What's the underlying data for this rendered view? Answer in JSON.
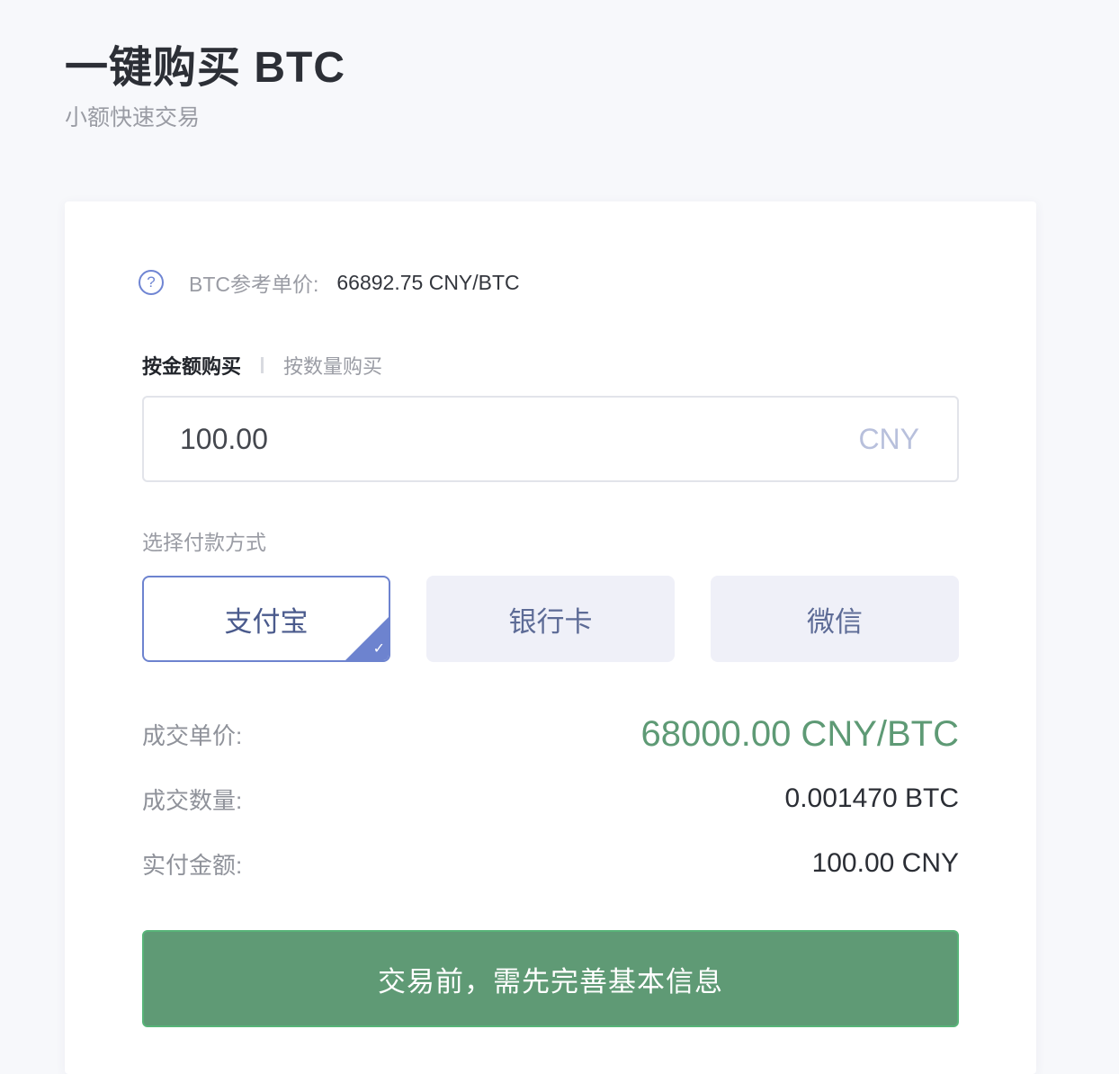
{
  "header": {
    "title": "一键购买 BTC",
    "subtitle": "小额快速交易"
  },
  "reference_price": {
    "icon": "help-icon",
    "icon_glyph": "?",
    "label": "BTC参考单价:",
    "value": "66892.75 CNY/BTC"
  },
  "purchase_tabs": [
    {
      "label": "按金额购买",
      "active": true
    },
    {
      "label": "按数量购买",
      "active": false
    }
  ],
  "amount_input": {
    "value": "100.00",
    "unit": "CNY"
  },
  "payment": {
    "label": "选择付款方式",
    "options": [
      {
        "label": "支付宝",
        "selected": true
      },
      {
        "label": "银行卡",
        "selected": false
      },
      {
        "label": "微信",
        "selected": false
      }
    ],
    "check_glyph": "✓"
  },
  "summary": {
    "unit_price_label": "成交单价:",
    "unit_price_value": "68000.00 CNY/BTC",
    "quantity_label": "成交数量:",
    "quantity_value": "0.001470 BTC",
    "paid_label": "实付金额:",
    "paid_value": "100.00 CNY"
  },
  "submit": {
    "label": "交易前，需先完善基本信息"
  },
  "colors": {
    "accent_blue": "#6d83cf",
    "price_green": "#5e9a75",
    "button_green": "#5f9a75"
  }
}
